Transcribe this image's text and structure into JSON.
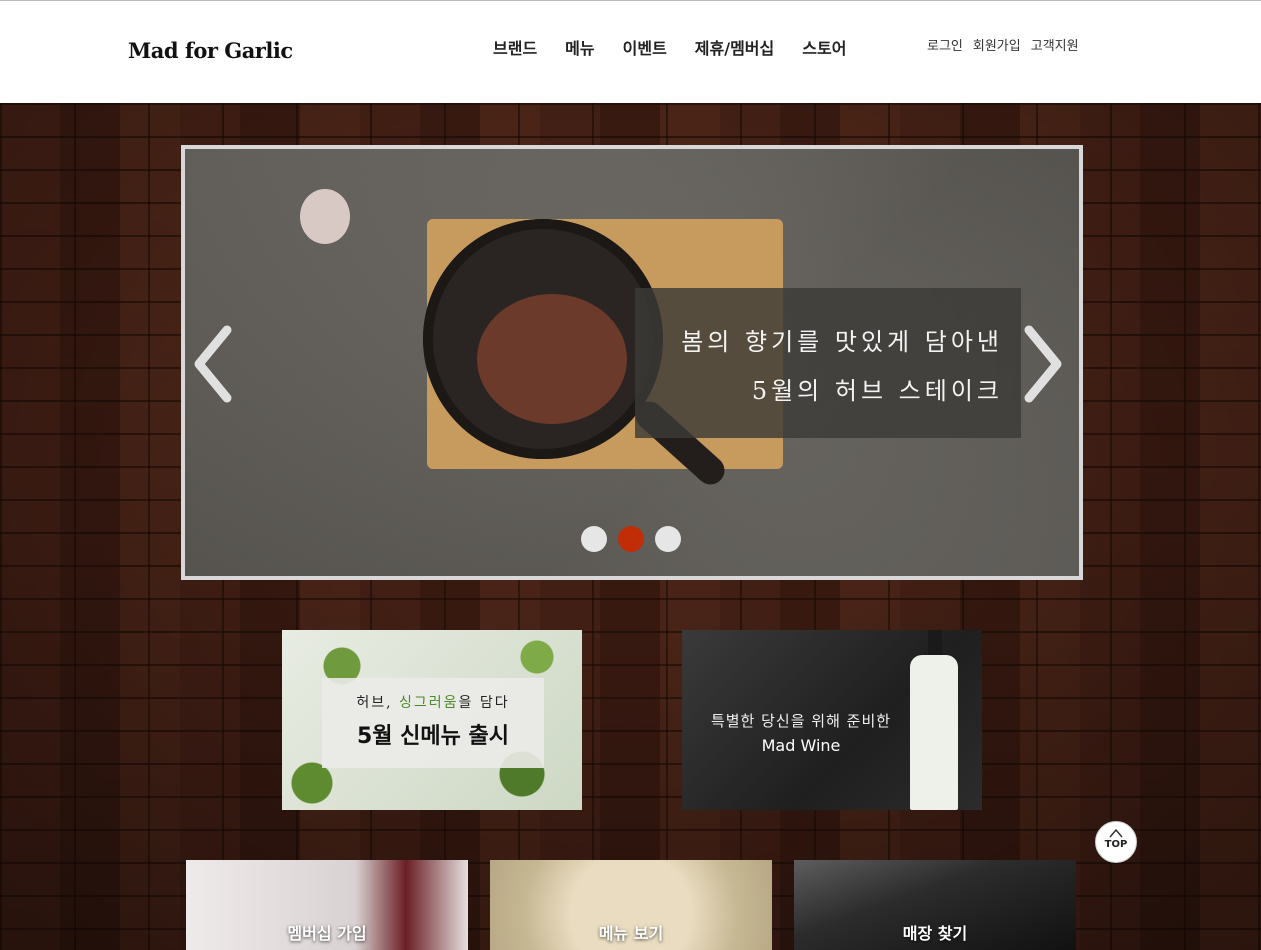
{
  "header": {
    "logo": "Mad for Garlic",
    "nav": [
      "브랜드",
      "메뉴",
      "이벤트",
      "제휴/멤버십",
      "스토어"
    ],
    "util": [
      "로그인",
      "회원가입",
      "고객지원"
    ]
  },
  "slider": {
    "caption_line1": "봄의 향기를 맛있게 담아낸",
    "caption_line2": "5월의 허브 스테이크",
    "dots": 3,
    "active_dot": 2
  },
  "promos": {
    "herb": {
      "sub_prefix": "허브, ",
      "sub_highlight": "싱그러움",
      "sub_suffix": "을 담다",
      "title": "5월 신메뉴 출시"
    },
    "wine": {
      "line1": "특별한 당신을 위해 준비한",
      "line2": "Mad Wine"
    }
  },
  "top_button": {
    "label": "TOP"
  },
  "cards": {
    "member": "멤버십 가입",
    "menu": "메뉴 보기",
    "store": "매장 찾기"
  },
  "colors": {
    "active_dot": "#c02d06",
    "brick": "#5a2a1c"
  }
}
